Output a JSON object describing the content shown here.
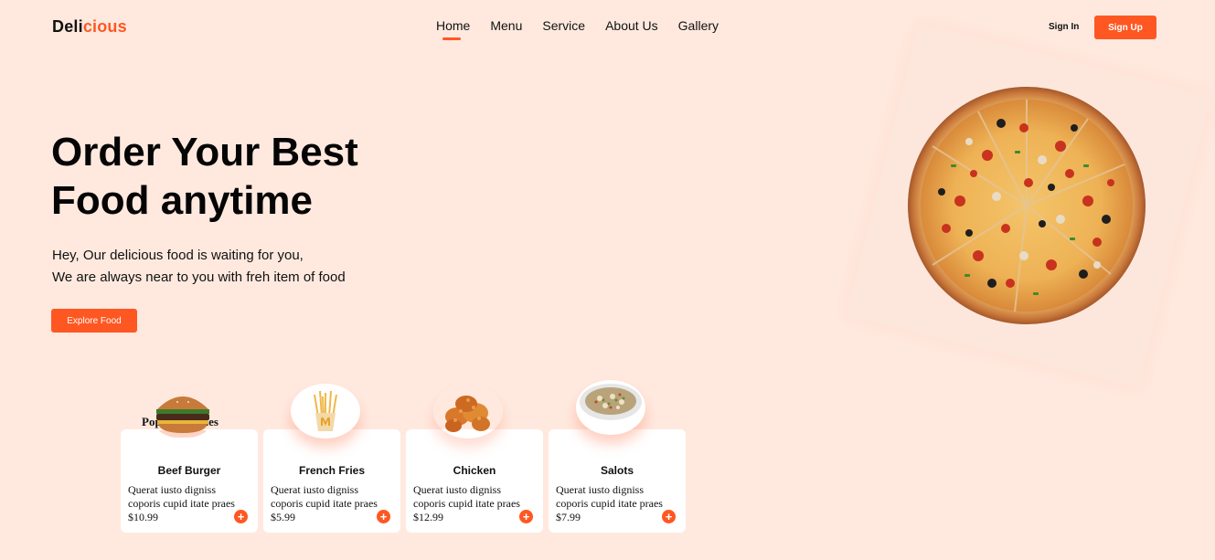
{
  "brand": {
    "part1": "Deli",
    "part2": "cious",
    "accent": "#ff5722"
  },
  "nav": {
    "items": [
      {
        "label": "Home",
        "active": true
      },
      {
        "label": "Menu"
      },
      {
        "label": "Service"
      },
      {
        "label": "About Us"
      },
      {
        "label": "Gallery"
      }
    ]
  },
  "auth": {
    "sign_in": "Sign In",
    "sign_up": "Sign Up"
  },
  "hero": {
    "title_line1": "Order Your Best",
    "title_line2": "Food anytime",
    "sub_line1": "Hey, Our delicious food is waiting for you,",
    "sub_line2": "We are always near to you with freh item of food",
    "cta": "Explore Food"
  },
  "popular": {
    "title": "Popular Dishes",
    "items": [
      {
        "name": "Beef Burger",
        "desc": "Querat iusto digniss coporis cupid itate praes",
        "price": "$10.99",
        "icon": "burger"
      },
      {
        "name": "French Fries",
        "desc": "Querat iusto digniss coporis cupid itate praes",
        "price": "$5.99",
        "icon": "fries"
      },
      {
        "name": "Chicken",
        "desc": "Querat iusto digniss coporis cupid itate praes",
        "price": "$12.99",
        "icon": "chicken"
      },
      {
        "name": "Salots",
        "desc": "Querat iusto digniss coporis cupid itate praes",
        "price": "$7.99",
        "icon": "salad"
      }
    ],
    "add_symbol": "+"
  },
  "colors": {
    "background": "#ffe9df",
    "accent": "#ff5722",
    "card": "#ffffff"
  }
}
